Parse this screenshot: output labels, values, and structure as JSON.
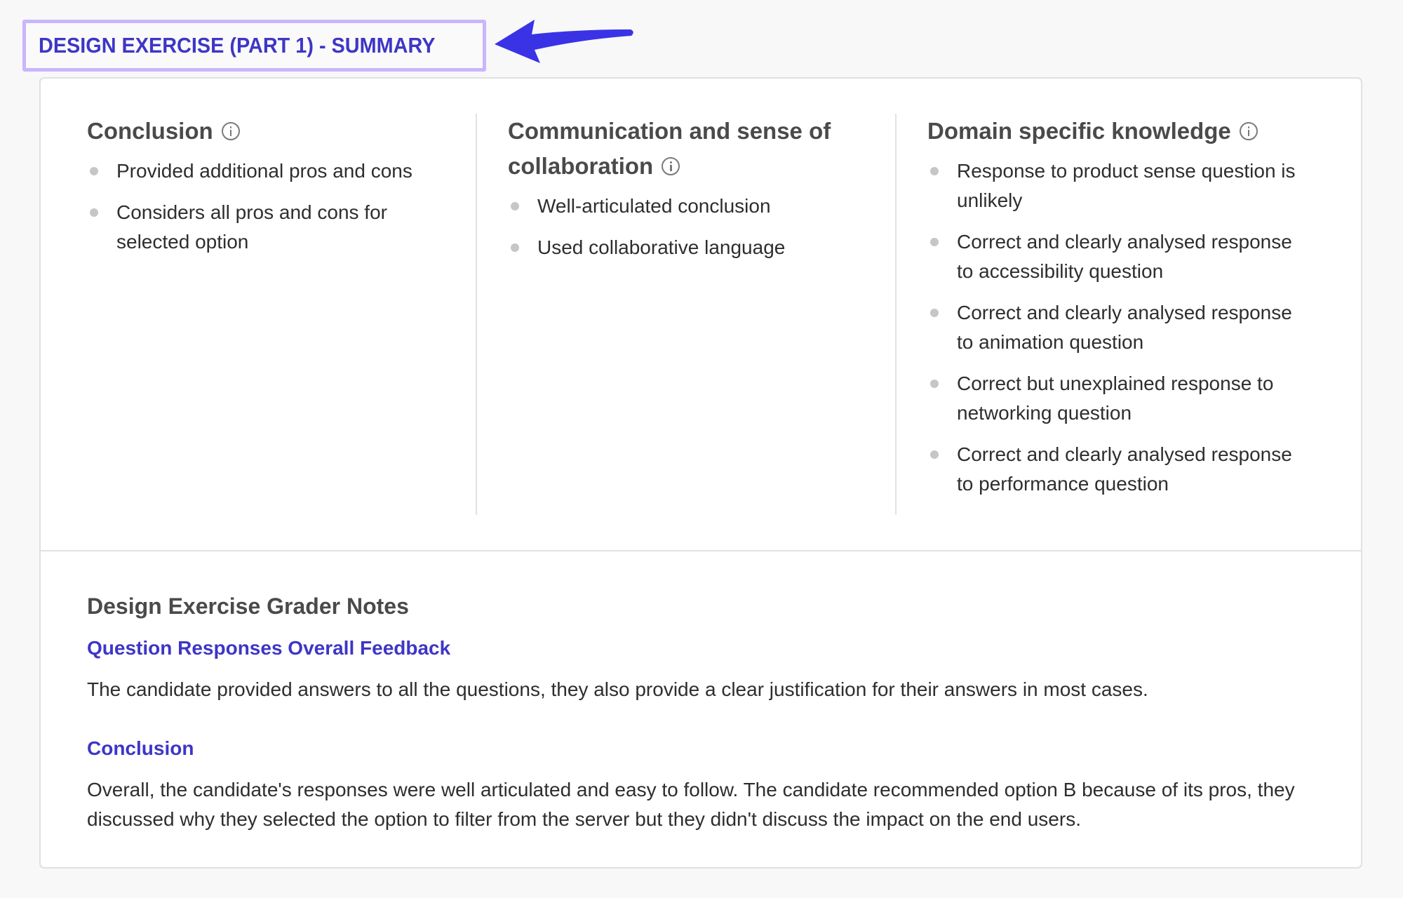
{
  "title": "DESIGN EXERCISE (PART 1) - SUMMARY",
  "colors": {
    "accent": "#3e36c6",
    "highlight_border": "#c9b6fb",
    "arrow": "#3a33e6",
    "bullet": "#c6c6c6",
    "heading_text": "#4a4a4a",
    "body_text": "#2e2e2e"
  },
  "annotation": {
    "arrow_icon": "arrow-left-icon"
  },
  "criteria": [
    {
      "heading": "Conclusion",
      "icon": "info-icon",
      "items": [
        "Provided additional pros and cons",
        "Considers all pros and cons for selected option"
      ]
    },
    {
      "heading": "Communication and sense of collaboration",
      "icon": "info-icon",
      "items": [
        "Well-articulated conclusion",
        "Used collaborative language"
      ]
    },
    {
      "heading": "Domain specific knowledge",
      "icon": "info-icon",
      "items": [
        "Response to product sense question is unlikely",
        "Correct and clearly analysed response to accessibility question",
        "Correct and clearly analysed response to animation question",
        "Correct but unexplained response to networking question",
        "Correct and clearly analysed response to performance question"
      ]
    }
  ],
  "notes": {
    "heading": "Design Exercise Grader Notes",
    "sections": [
      {
        "title": "Question Responses Overall Feedback",
        "text": "The candidate provided answers to all the questions, they also provide a clear justification for their answers in most cases."
      },
      {
        "title": "Conclusion",
        "text": "Overall, the candidate's responses were well articulated and easy to follow. The candidate recommended option B because of its pros, they discussed why they selected the option to filter from the server but they didn't discuss the impact on the end users."
      }
    ]
  }
}
